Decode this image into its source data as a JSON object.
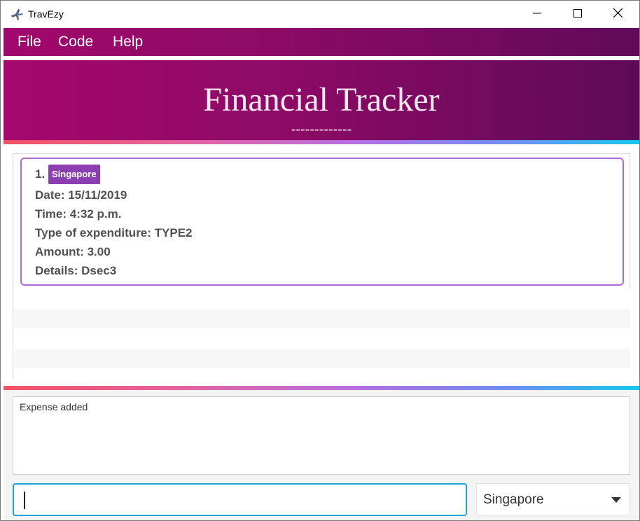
{
  "window": {
    "title": "TravEzy",
    "minimize_icon": "minimize-icon",
    "maximize_icon": "maximize-icon",
    "close_icon": "close-icon"
  },
  "menu": {
    "items": [
      {
        "label": "File"
      },
      {
        "label": "Code"
      },
      {
        "label": "Help"
      }
    ]
  },
  "header": {
    "title": "Financial Tracker",
    "underline": "-------------"
  },
  "expenses": [
    {
      "index": "1.",
      "tag": "Singapore",
      "date": "Date: 15/11/2019",
      "time": "Time: 4:32 p.m.",
      "type": "Type of expenditure: TYPE2",
      "amount": "Amount: 3.00",
      "details": "Details: Dsec3"
    }
  ],
  "result": {
    "message": "Expense added"
  },
  "command": {
    "value": ""
  },
  "country_select": {
    "selected": "Singapore"
  },
  "colors": {
    "banner_start": "#a6086d",
    "banner_end": "#5e0a58",
    "tag": "#8c3fb0",
    "card_border": "#b06ad6",
    "input_focus": "#1da5d8"
  }
}
